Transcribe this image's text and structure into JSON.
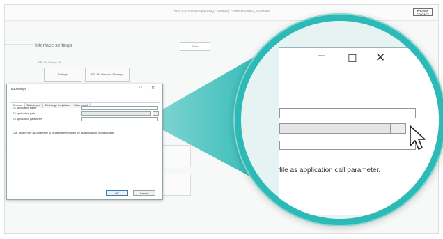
{
  "window": {
    "title": "PROFICY software planning - 230806 | PhoenixContact_Showcase",
    "brand_logo": "PHOENIX CONTACT"
  },
  "main": {
    "section_title": "Interface settings",
    "save_label": "Save",
    "group_label": "EPLAN Electric P8",
    "settings_button_label": "Settings",
    "interface_manager_label": "EPLAN Interface Manager"
  },
  "dialog": {
    "title": "E3 Settings",
    "tabs": [
      "General",
      "Data import",
      "Exchange templates",
      "Data export"
    ],
    "active_tab": 0,
    "rows": [
      {
        "label": "E3 application name",
        "value": ""
      },
      {
        "label": "E3 application path",
        "value": ""
      },
      {
        "label": "E3 application parameter",
        "value": ""
      }
    ],
    "hint": "Use .dsoexFilter as parameter to forward the exported file as application call parameter.",
    "ok_label": "OK",
    "cancel_label": "Cancel"
  },
  "magnifier": {
    "hint_text": "file as application call parameter.",
    "browse_label": "..."
  },
  "colors": {
    "accent_teal": "#2dbab6",
    "teal_light": "#7fd6d2",
    "dialog_border": "#8fa7b0"
  },
  "icons": [
    "minimize-icon",
    "maximize-icon",
    "close-icon",
    "mouse-cursor-icon"
  ]
}
